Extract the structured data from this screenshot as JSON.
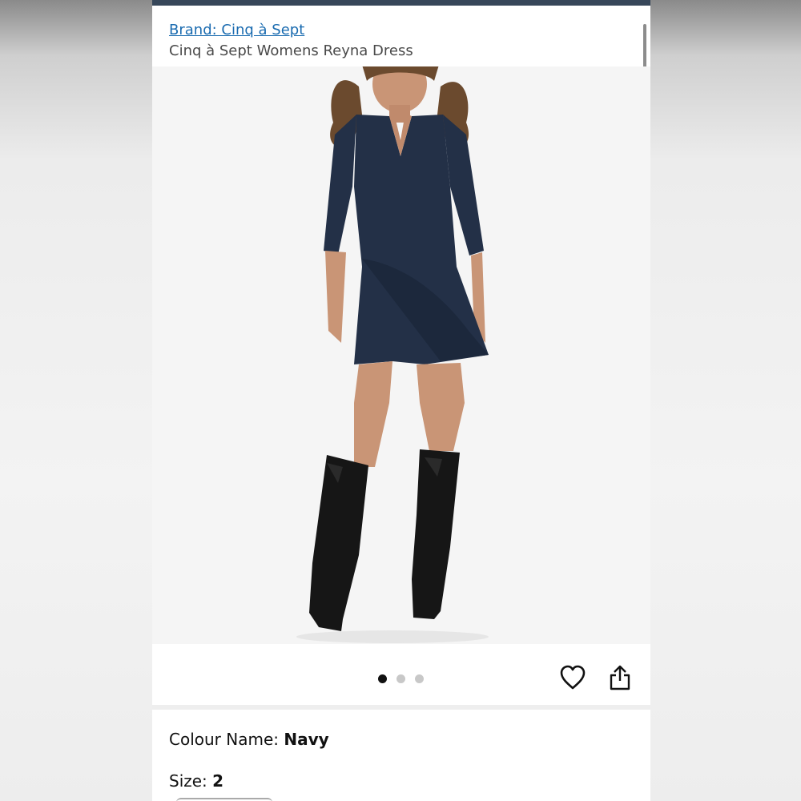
{
  "header": {
    "brand_link": "Brand: Cinq à Sept",
    "product_title": "Cinq à Sept Womens Reyna Dress"
  },
  "image_gallery": {
    "image_subject": "model-wearing-navy-wrap-dress-and-black-boots",
    "dot_count": 3,
    "active_dot": 1
  },
  "actions": {
    "wishlist_icon": "heart-icon",
    "share_icon": "share-icon"
  },
  "attributes": {
    "colour_label": "Colour Name: ",
    "colour_value": "Navy",
    "size_label": "Size: ",
    "size_value": "2"
  },
  "colors": {
    "link": "#1a6bb0",
    "top_bar": "#37475a",
    "dress": "#233047"
  }
}
